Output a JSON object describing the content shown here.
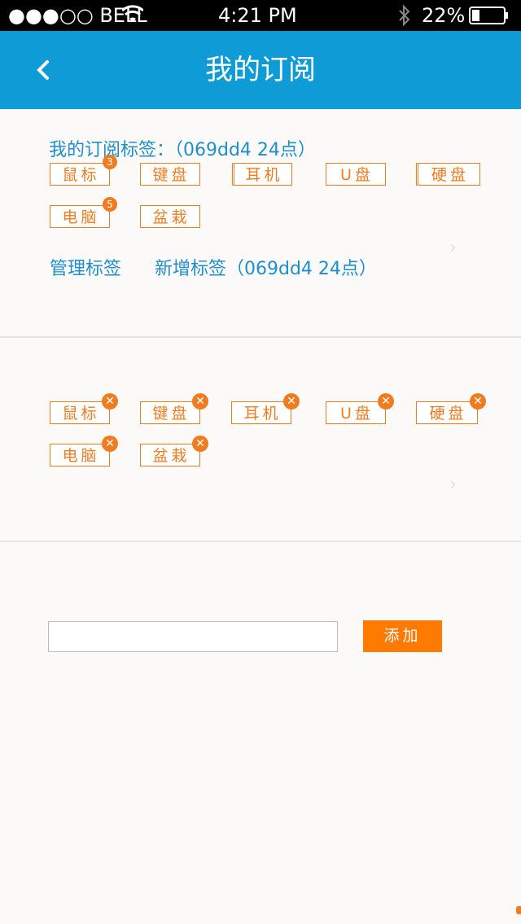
{
  "statusbar": {
    "carrier": "●●●○○ BELL",
    "time": "4:21 PM",
    "battery": "22%"
  },
  "navbar": {
    "title": "我的订阅"
  },
  "section1": {
    "heading": "我的订阅标签：（069dd4 24点）",
    "tags": [
      {
        "label": "鼠标",
        "badge": "3"
      },
      {
        "label": "键盘"
      },
      {
        "label": "耳机"
      },
      {
        "label": "U盘"
      },
      {
        "label": "硬盘"
      },
      {
        "label": "电脑",
        "badge": "5"
      },
      {
        "label": "盆栽"
      }
    ],
    "manage_label": "管理标签",
    "add_tags_label": "新增标签（069dd4 24点）"
  },
  "section2": {
    "tags": [
      {
        "label": "鼠标"
      },
      {
        "label": "键盘"
      },
      {
        "label": "耳机"
      },
      {
        "label": "U盘"
      },
      {
        "label": "硬盘"
      },
      {
        "label": "电脑"
      },
      {
        "label": "盆栽"
      }
    ]
  },
  "add_form": {
    "input_value": "",
    "placeholder": "",
    "button_label": "添加"
  },
  "colors": {
    "primary": "#0e9bd6",
    "accent": "#f07c22",
    "button": "#ff7a00"
  }
}
